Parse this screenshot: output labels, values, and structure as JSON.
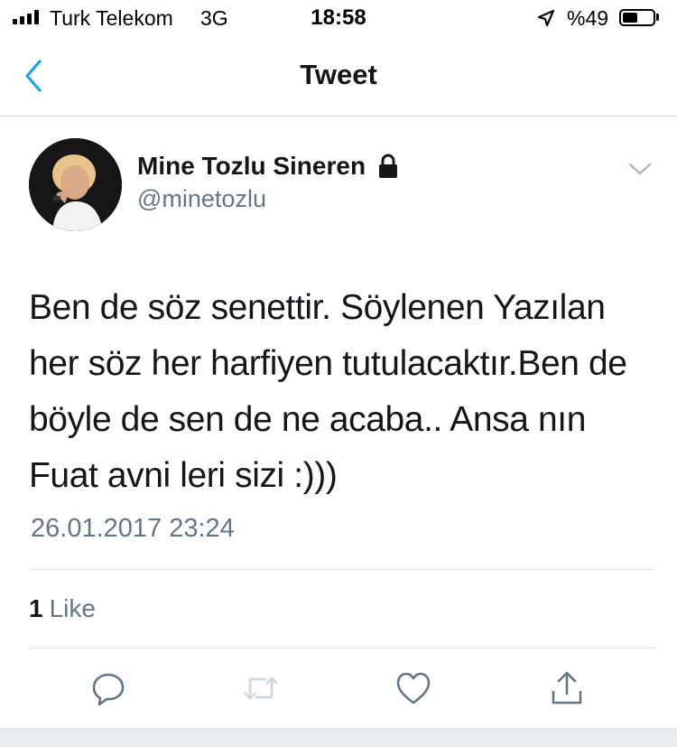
{
  "status_bar": {
    "carrier": "Turk Telekom",
    "network": "3G",
    "time": "18:58",
    "battery_percent_label": "%49",
    "battery_level": 0.49,
    "icons": [
      "signal-bars-icon",
      "location-arrow-icon",
      "battery-icon"
    ]
  },
  "nav": {
    "title": "Tweet",
    "back_icon": "chevron-left-icon",
    "accent_color": "#1da1f2"
  },
  "tweet": {
    "author": {
      "display_name": "Mine Tozlu Sineren",
      "username": "@minetozlu",
      "protected_icon": "lock-icon"
    },
    "text": "Ben de söz senettir. Söylenen Yazılan her söz her harfiyen tutulacaktır.Ben de böyle de sen de ne acaba.. Ansa nın Fuat avni leri sizi :)))",
    "timestamp": "26.01.2017 23:24",
    "likes": {
      "count": "1",
      "label": "Like"
    }
  },
  "actions": [
    {
      "icon": "reply-icon"
    },
    {
      "icon": "retweet-icon"
    },
    {
      "icon": "heart-icon"
    },
    {
      "icon": "share-icon"
    }
  ],
  "colors": {
    "text_primary": "#14171a",
    "text_secondary": "#657786",
    "icon_gray": "#657786",
    "divider": "#dfe3e6"
  }
}
